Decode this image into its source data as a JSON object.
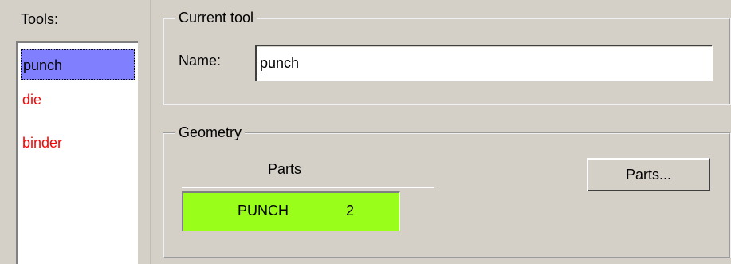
{
  "tools": {
    "label": "Tools:",
    "items": [
      {
        "label": "punch",
        "selected": true
      },
      {
        "label": "die",
        "selected": false
      },
      {
        "label": "binder",
        "selected": false
      }
    ]
  },
  "current_tool": {
    "title": "Current tool",
    "name_label": "Name:",
    "name_value": "punch"
  },
  "geometry": {
    "title": "Geometry",
    "parts_header": "Parts",
    "parts": [
      {
        "name": "PUNCH",
        "count": "2"
      }
    ],
    "parts_button_label": "Parts..."
  },
  "colors": {
    "selected_bg": "#8080ff",
    "unselected_text": "#ff0000",
    "parts_row_bg": "#99ff1a"
  }
}
